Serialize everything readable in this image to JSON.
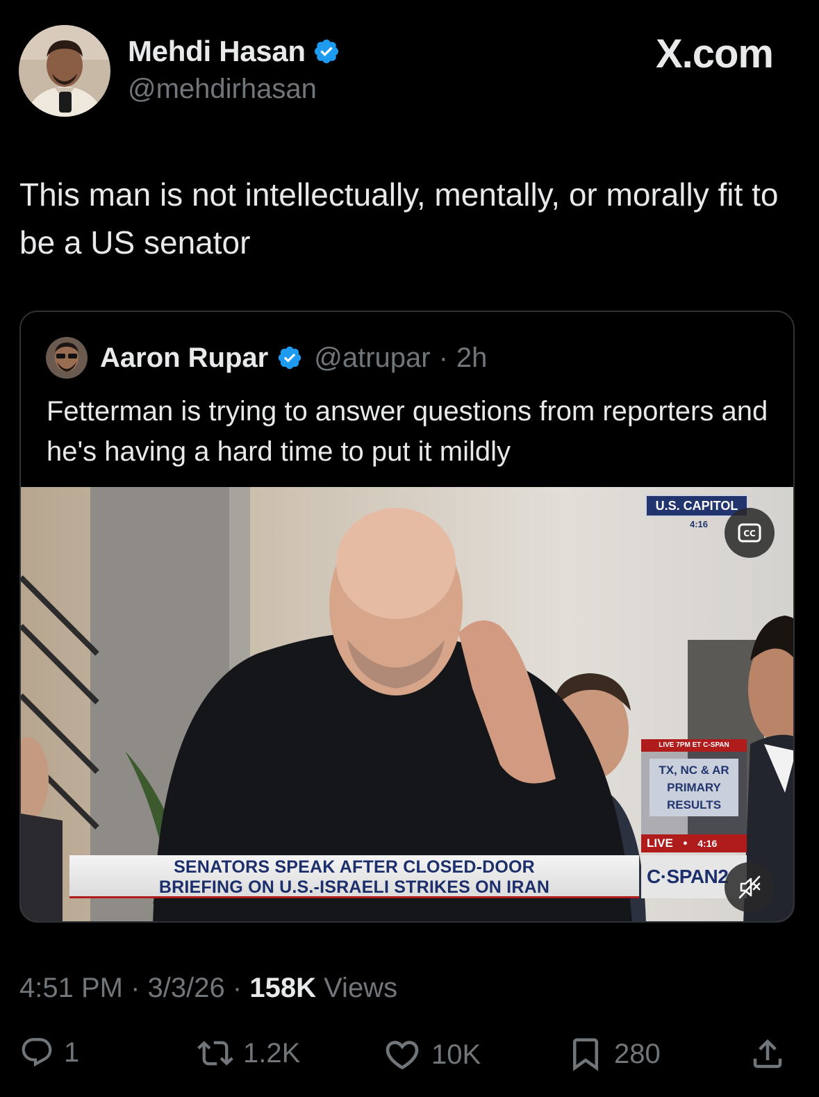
{
  "post": {
    "author_name": "Mehdi Hasan",
    "author_handle": "@mehdirhasan",
    "brand": "X.com",
    "text": "This man is not intellectually, mentally, or morally fit to be a US senator"
  },
  "quote": {
    "author_name": "Aaron Rupar",
    "author_handle": "@atrupar",
    "separator": "·",
    "age": "2h",
    "text": "Fetterman is trying to answer questions from reporters and he's having a hard time to put it mildly",
    "video": {
      "location_label": "U.S. CAPITOL",
      "location_time": "4:16",
      "chyron_line1": "SENATORS SPEAK AFTER CLOSED-DOOR",
      "chyron_line2": "BRIEFING ON U.S.-ISRAELI STRIKES ON IRAN",
      "promo_tag": "LIVE 7PM ET C-SPAN",
      "promo_line1": "TX, NC & AR",
      "promo_line2": "PRIMARY",
      "promo_line3": "RESULTS",
      "live_label": "LIVE",
      "live_time": "4:16",
      "network": "C·SPAN2",
      "cc_icon": "closed-captions-icon",
      "mute_icon": "muted-speaker-icon"
    }
  },
  "meta": {
    "time": "4:51 PM",
    "date": "3/3/26",
    "views_count": "158K",
    "views_label": "Views",
    "dot": "·"
  },
  "actions": {
    "replies": "1",
    "reposts": "1.2K",
    "likes": "10K",
    "bookmarks": "280"
  },
  "colors": {
    "background": "#000000",
    "text": "#e7e9ea",
    "muted": "#71767b",
    "verified": "#1d9bf0",
    "border": "#2f3336"
  }
}
